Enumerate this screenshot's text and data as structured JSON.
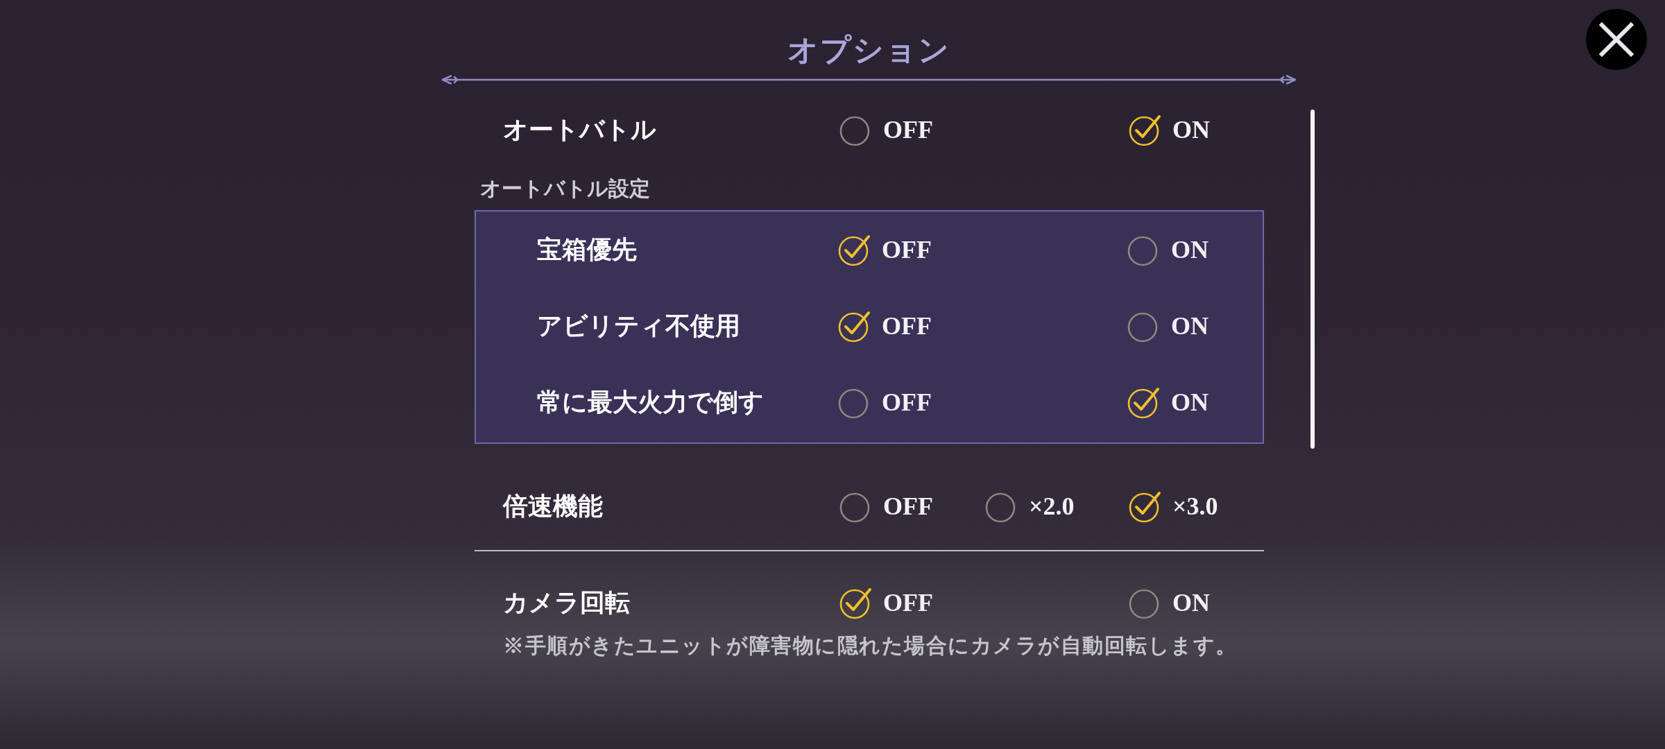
{
  "title": "オプション",
  "settings": [
    {
      "kind": "toggle",
      "label": "オートバトル",
      "options": [
        {
          "label": "OFF",
          "selected": false
        },
        {
          "label": "ON",
          "selected": true
        }
      ]
    },
    {
      "kind": "group",
      "label": "オートバトル設定",
      "items": [
        {
          "label": "宝箱優先",
          "options": [
            {
              "label": "OFF",
              "selected": true
            },
            {
              "label": "ON",
              "selected": false
            }
          ]
        },
        {
          "label": "アビリティ不使用",
          "options": [
            {
              "label": "OFF",
              "selected": true
            },
            {
              "label": "ON",
              "selected": false
            }
          ]
        },
        {
          "label": "常に最大火力で倒す",
          "options": [
            {
              "label": "OFF",
              "selected": false
            },
            {
              "label": "ON",
              "selected": true
            }
          ]
        }
      ]
    },
    {
      "kind": "toggle",
      "label": "倍速機能",
      "options": [
        {
          "label": "OFF",
          "selected": false
        },
        {
          "label": "×2.0",
          "selected": false
        },
        {
          "label": "×3.0",
          "selected": true
        }
      ]
    },
    {
      "kind": "divider"
    },
    {
      "kind": "toggle",
      "label": "カメラ回転",
      "options": [
        {
          "label": "OFF",
          "selected": true
        },
        {
          "label": "ON",
          "selected": false
        }
      ],
      "note": "※手順がきたユニットが障害物に隠れた場合にカメラが自動回転します。"
    }
  ]
}
